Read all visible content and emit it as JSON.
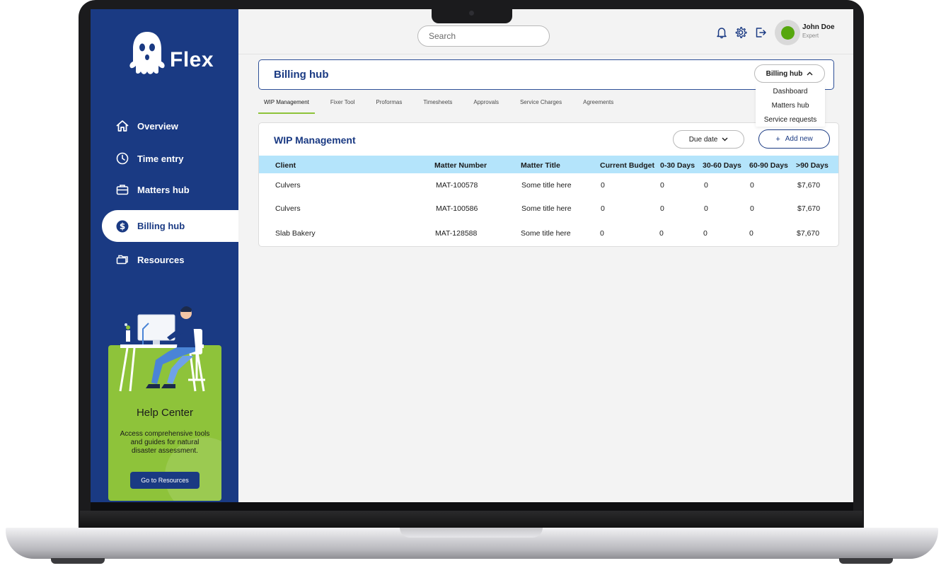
{
  "app": {
    "name": "Flex"
  },
  "sidebar": {
    "items": [
      {
        "label": "Overview"
      },
      {
        "label": "Time entry"
      },
      {
        "label": "Matters hub"
      },
      {
        "label": "Billing hub"
      },
      {
        "label": "Resources"
      }
    ],
    "active_index": 3,
    "help_card": {
      "title": "Help Center",
      "description": "Access comprehensive tools and guides for natural disaster assessment.",
      "button_label": "Go to Resources"
    }
  },
  "topbar": {
    "search_placeholder": "Search",
    "user": {
      "name": "John Doe",
      "role": "Expert",
      "status_color": "#55a70d"
    }
  },
  "page": {
    "title": "Billing hub",
    "hub_select": {
      "label": "Billing hub"
    },
    "dropdown_items": [
      "Dashboard",
      "Matters hub",
      "Service requests"
    ]
  },
  "tabs": [
    {
      "label": "WIP Management"
    },
    {
      "label": "Fixer Tool"
    },
    {
      "label": "Proformas"
    },
    {
      "label": "Timesheets"
    },
    {
      "label": "Approvals"
    },
    {
      "label": "Service Charges"
    },
    {
      "label": "Agreements"
    }
  ],
  "wip": {
    "title": "WIP Management",
    "filter_label": "Due date",
    "add_label": "Add new",
    "columns": [
      "Client",
      "Matter Number",
      "Matter Title",
      "Current Budget",
      "0-30 Days",
      "30-60 Days",
      "60-90 Days",
      ">90 Days"
    ],
    "rows": [
      [
        "Culvers",
        "MAT-100578",
        "Some title here",
        "0",
        "0",
        "0",
        "0",
        "$7,670"
      ],
      [
        "Culvers",
        "MAT-100586",
        "Some title here",
        "0",
        "0",
        "0",
        "0",
        "$7,670"
      ],
      [
        "Slab Bakery",
        "MAT-128588",
        "Some title here",
        "0",
        "0",
        "0",
        "0",
        "$7,670"
      ]
    ]
  },
  "colors": {
    "primary": "#1a3a83",
    "accent": "#8ec33a",
    "table_header": "#b4e4fb",
    "background": "#f3f3f3"
  }
}
